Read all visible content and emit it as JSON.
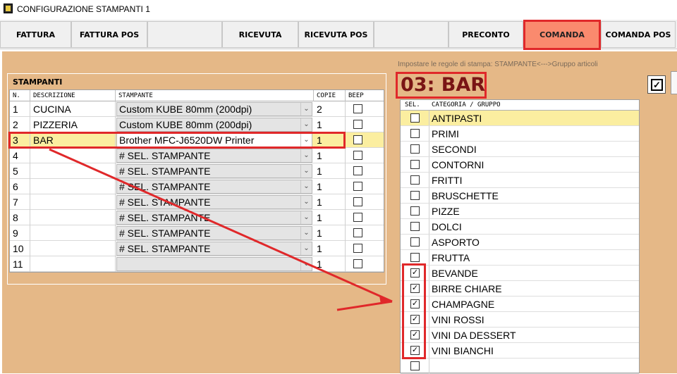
{
  "window": {
    "title": "CONFIGURAZIONE STAMPANTI 1"
  },
  "tabs": [
    {
      "label": "FATTURA"
    },
    {
      "label": "FATTURA POS"
    },
    {
      "label": ""
    },
    {
      "label": "RICEVUTA"
    },
    {
      "label": "RICEVUTA POS"
    },
    {
      "label": ""
    },
    {
      "label": "PRECONTO"
    },
    {
      "label": "COMANDA"
    },
    {
      "label": "COMANDA POS"
    }
  ],
  "active_tab": "COMANDA",
  "printers_panel": {
    "title": "STAMPANTI",
    "columns": [
      "N.",
      "DESCRIZIONE",
      "STAMPANTE",
      "COPIE",
      "BEEP"
    ],
    "rows": [
      {
        "n": "1",
        "descr": "CUCINA",
        "printer": "Custom KUBE 80mm (200dpi)",
        "copies": "2",
        "beep": false
      },
      {
        "n": "2",
        "descr": "PIZZERIA",
        "printer": "Custom KUBE 80mm (200dpi)",
        "copies": "1",
        "beep": false
      },
      {
        "n": "3",
        "descr": "BAR",
        "printer": "Brother MFC-J6520DW Printer",
        "copies": "1",
        "beep": false
      },
      {
        "n": "4",
        "descr": "",
        "printer": "# SEL. STAMPANTE",
        "copies": "1",
        "beep": false
      },
      {
        "n": "5",
        "descr": "",
        "printer": "# SEL. STAMPANTE",
        "copies": "1",
        "beep": false
      },
      {
        "n": "6",
        "descr": "",
        "printer": "# SEL. STAMPANTE",
        "copies": "1",
        "beep": false
      },
      {
        "n": "7",
        "descr": "",
        "printer": "# SEL. STAMPANTE",
        "copies": "1",
        "beep": false
      },
      {
        "n": "8",
        "descr": "",
        "printer": "# SEL. STAMPANTE",
        "copies": "1",
        "beep": false
      },
      {
        "n": "9",
        "descr": "",
        "printer": "# SEL. STAMPANTE",
        "copies": "1",
        "beep": false
      },
      {
        "n": "10",
        "descr": "",
        "printer": "# SEL. STAMPANTE",
        "copies": "1",
        "beep": false
      },
      {
        "n": "11",
        "descr": "",
        "printer": "",
        "copies": "1",
        "beep": false
      }
    ],
    "selected_row": "3"
  },
  "rules_panel": {
    "label": "Impostare le regole di stampa:  STAMPANTE<--->Gruppo articoli",
    "printer_title": "03: BAR",
    "columns": [
      "SEL.",
      "CATEGORIA / GRUPPO"
    ],
    "categories": [
      {
        "name": "ANTIPASTI",
        "checked": false
      },
      {
        "name": "PRIMI",
        "checked": false
      },
      {
        "name": "SECONDI",
        "checked": false
      },
      {
        "name": "CONTORNI",
        "checked": false
      },
      {
        "name": "FRITTI",
        "checked": false
      },
      {
        "name": "BRUSCHETTE",
        "checked": false
      },
      {
        "name": "PIZZE",
        "checked": false
      },
      {
        "name": "DOLCI",
        "checked": false
      },
      {
        "name": "ASPORTO",
        "checked": false
      },
      {
        "name": "FRUTTA",
        "checked": false
      },
      {
        "name": "BEVANDE",
        "checked": true
      },
      {
        "name": "BIRRE CHIARE",
        "checked": true
      },
      {
        "name": "CHAMPAGNE",
        "checked": true
      },
      {
        "name": "VINI ROSSI",
        "checked": true
      },
      {
        "name": "VINI DA DESSERT",
        "checked": true
      },
      {
        "name": "VINI BIANCHI",
        "checked": true
      },
      {
        "name": "",
        "checked": false
      }
    ]
  },
  "colors": {
    "accent_red": "#e0282a",
    "active_tab_bg": "#fa8a6e",
    "panel_bg": "#e5b887",
    "selected_row_bg": "#fbeea0",
    "bar_title_color": "#7a1515"
  }
}
